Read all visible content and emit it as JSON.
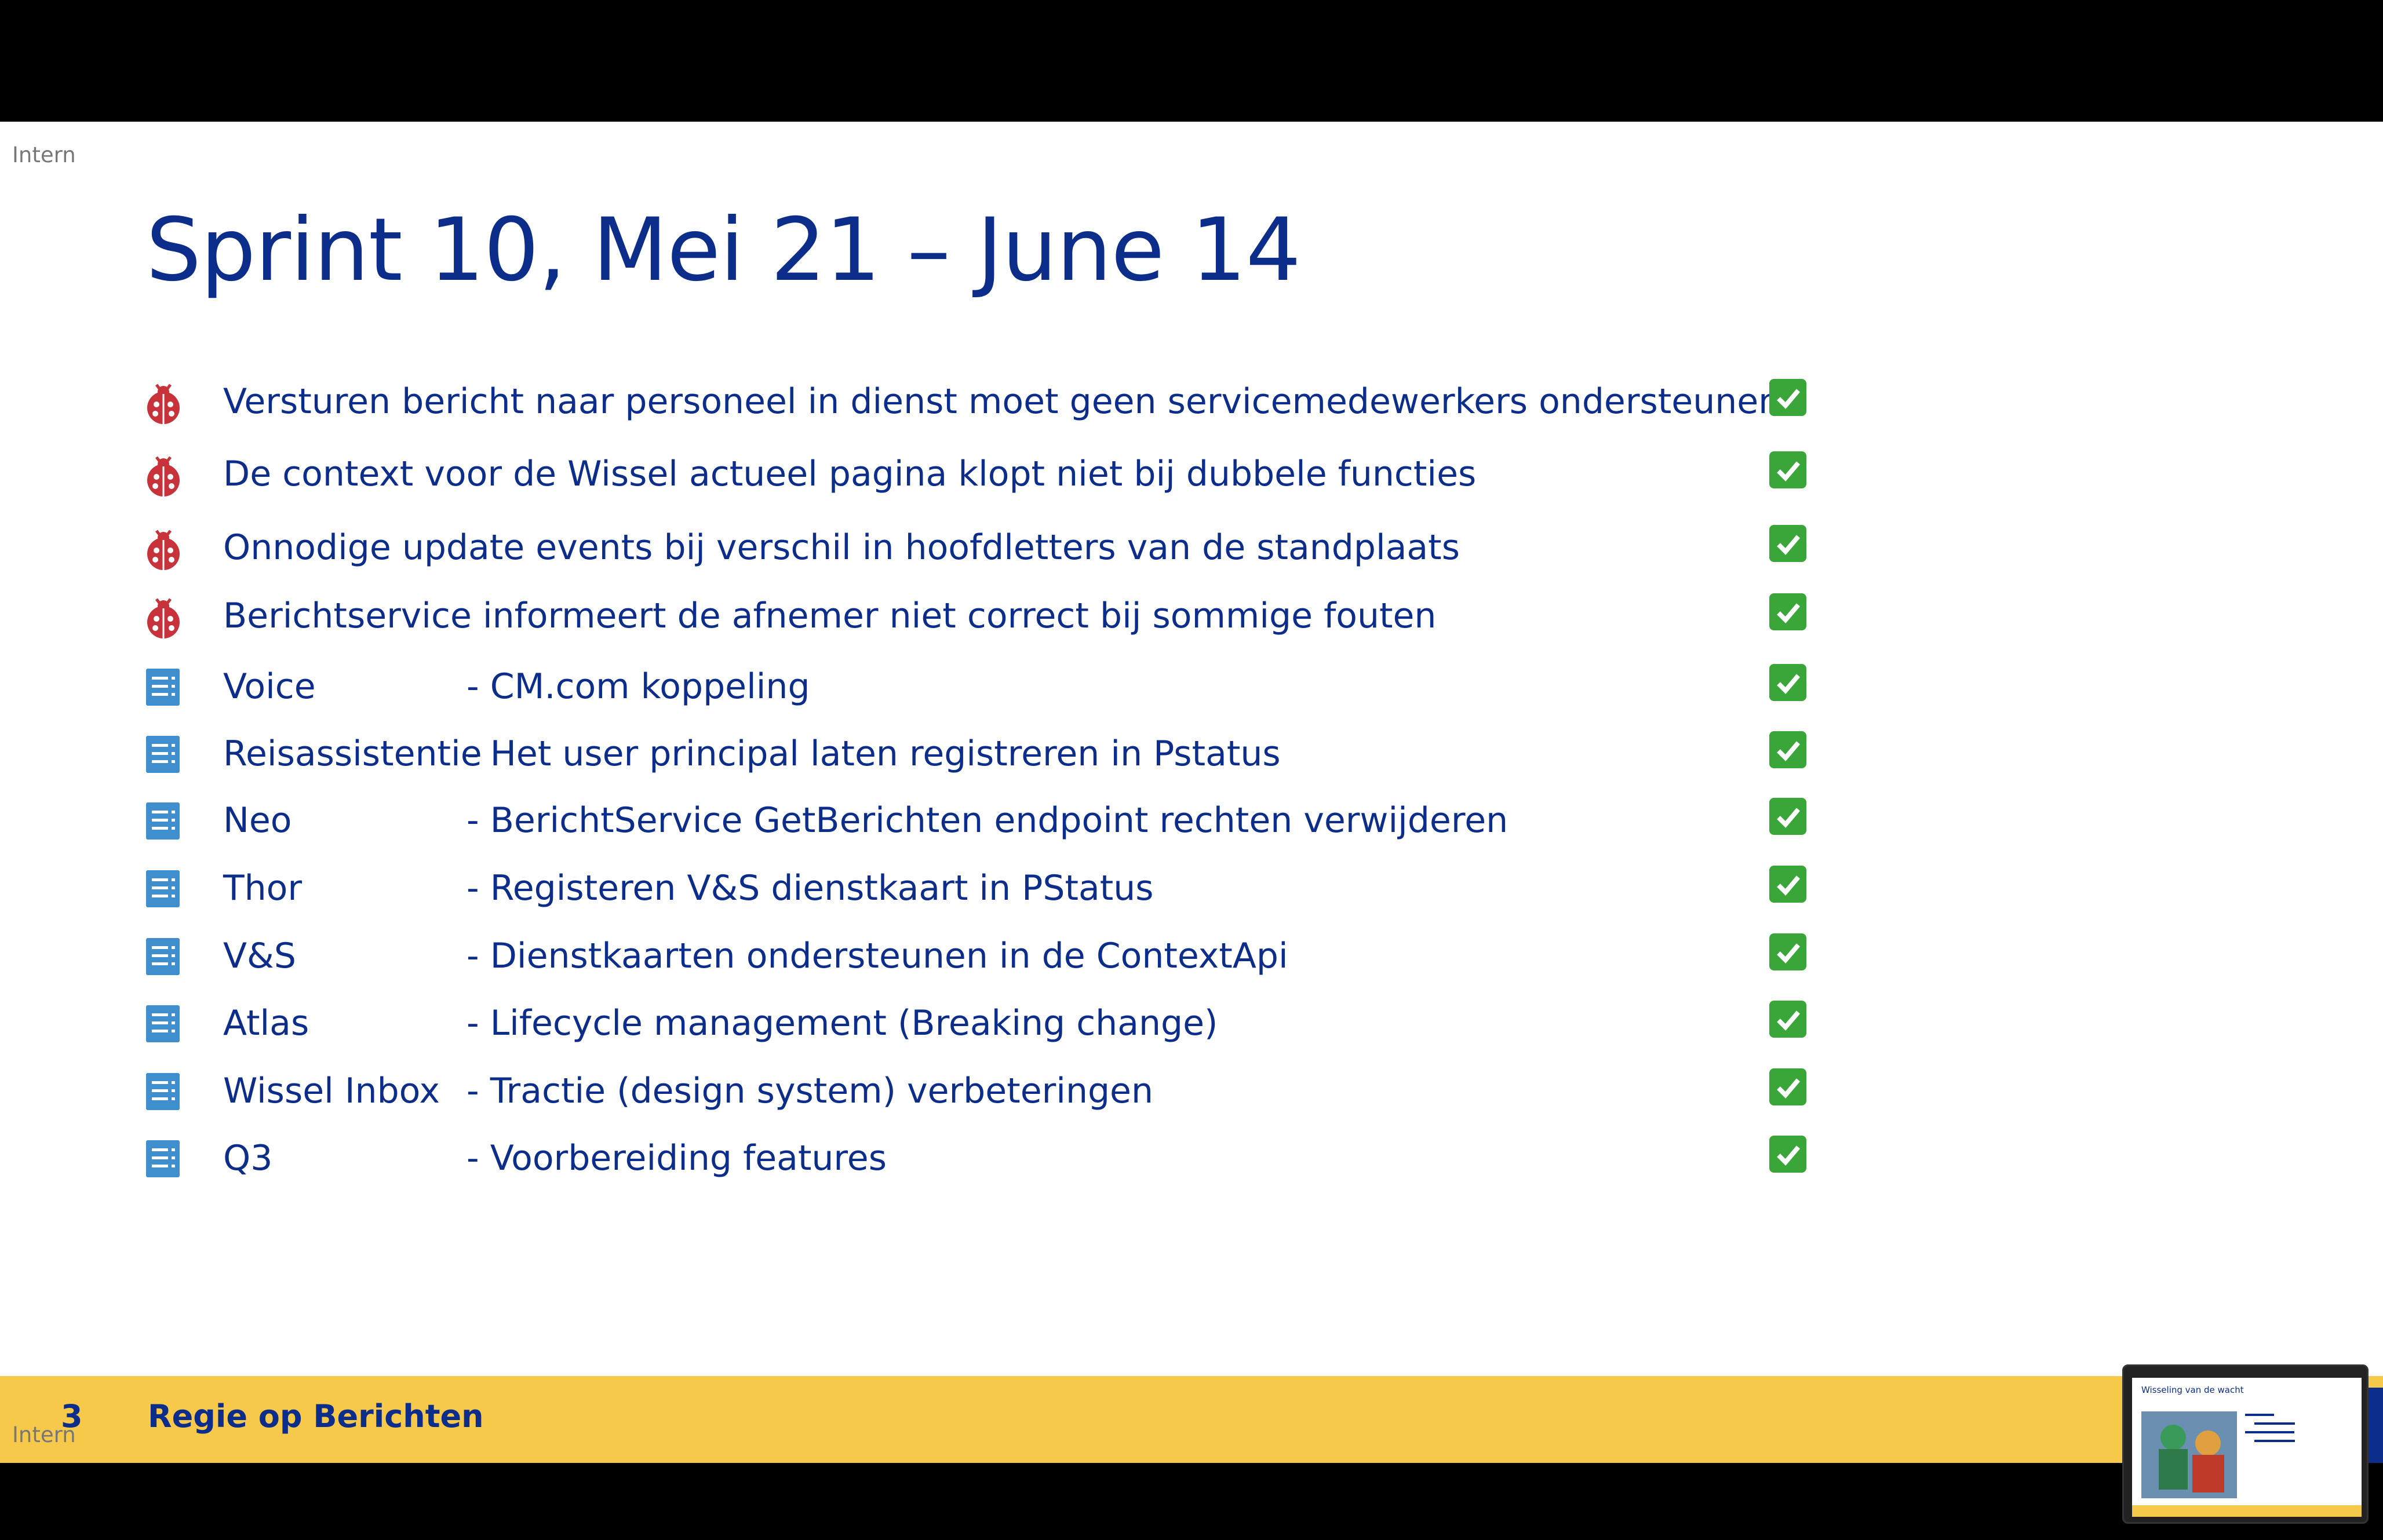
{
  "slide": {
    "label": "Intern",
    "title": "Sprint 10, Mei 21 – June 14"
  },
  "items": [
    {
      "type": "bug",
      "text": "Versturen bericht naar personeel in dienst moet geen servicemedewerkers ondersteunen",
      "done": true
    },
    {
      "type": "bug",
      "text": "De context voor de Wissel actueel pagina klopt niet bij dubbele functies",
      "done": true
    },
    {
      "type": "bug",
      "text": "Onnodige update events bij verschil in hoofdletters van de standplaats",
      "done": true
    },
    {
      "type": "bug",
      "text": "Berichtservice informeert de afnemer niet correct bij sommige fouten",
      "done": true
    },
    {
      "type": "story",
      "name": "Voice",
      "desc": "- CM.com koppeling",
      "done": true
    },
    {
      "type": "story",
      "name": "Reisassistentie",
      "desc": "- Het user principal laten registreren in Pstatus",
      "done": true
    },
    {
      "type": "story",
      "name": "Neo",
      "desc": "- BerichtService GetBerichten endpoint rechten verwijderen",
      "done": true
    },
    {
      "type": "story",
      "name": "Thor",
      "desc": "- Registeren V&S dienstkaart in PStatus",
      "done": true
    },
    {
      "type": "story",
      "name": "V&S",
      "desc": "- Dienstkaarten ondersteunen in de ContextApi",
      "done": true
    },
    {
      "type": "story",
      "name": "Atlas",
      "desc": "- Lifecycle management (Breaking change)",
      "done": true
    },
    {
      "type": "story",
      "name": "Wissel Inbox",
      "desc": " - Tractie (design system) verbeteringen",
      "done": true
    },
    {
      "type": "story",
      "name": "Q3",
      "desc": "- Voorbereiding features",
      "done": true
    }
  ],
  "footer": {
    "page_number": "3",
    "title": "Regie op Berichten",
    "label": "Intern"
  },
  "thumbnail": {
    "title": "Wisseling van de wacht"
  },
  "colors": {
    "title": "#0d2d8a",
    "band": "#f6c94a",
    "bug": "#c8323a",
    "story": "#3f8fcf",
    "check": "#3aa63a"
  },
  "icons": {
    "bug": "ladybug-icon",
    "story": "list-icon",
    "done": "checkmark-icon"
  }
}
